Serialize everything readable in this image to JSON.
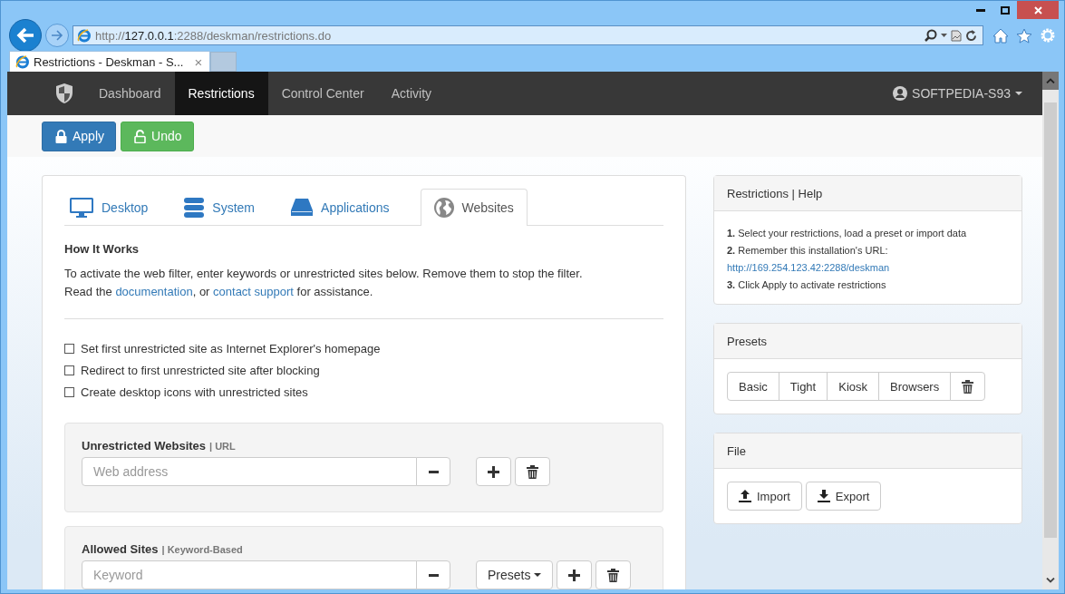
{
  "browser": {
    "address": {
      "scheme": "http://",
      "host": "127.0.0.1",
      "path": ":2288/deskman/restrictions.do"
    },
    "tabs": [
      {
        "title": "Restrictions - Deskman - S...",
        "close": "×",
        "selected": true
      }
    ]
  },
  "navbar": {
    "items": [
      {
        "label": "Dashboard",
        "selected": false
      },
      {
        "label": "Restrictions",
        "selected": true
      },
      {
        "label": "Control Center",
        "selected": false
      },
      {
        "label": "Activity",
        "selected": false
      }
    ],
    "user": "SOFTPEDIA-S93"
  },
  "toolbar": {
    "buttons": [
      {
        "label": "Apply",
        "kind": "primary"
      },
      {
        "label": "Undo",
        "kind": "success"
      }
    ]
  },
  "category_tabs": [
    {
      "label": "Desktop",
      "selected": false
    },
    {
      "label": "System",
      "selected": false
    },
    {
      "label": "Applications",
      "selected": false
    },
    {
      "label": "Websites",
      "selected": true
    }
  ],
  "how_it_works": {
    "heading": "How It Works",
    "line_1": "To activate the web filter, enter keywords or unrestricted sites below. Remove them to stop the filter.",
    "line_2": [
      {
        "kind": "text",
        "text": "Read the "
      },
      {
        "kind": "link",
        "text": "documentation"
      },
      {
        "kind": "text",
        "text": ", or "
      },
      {
        "kind": "link",
        "text": "contact support"
      },
      {
        "kind": "text",
        "text": " for assistance."
      }
    ]
  },
  "options": [
    {
      "label": "Set first unrestricted site as Internet Explorer's homepage",
      "checked": false
    },
    {
      "label": "Redirect to first unrestricted site after blocking",
      "checked": false
    },
    {
      "label": "Create desktop icons with unrestricted sites",
      "checked": false
    }
  ],
  "sections": [
    {
      "title": "Unrestricted Websites",
      "subtitle": "| URL",
      "placeholder": "Web address"
    },
    {
      "title": "Allowed Sites",
      "subtitle": "| Keyword-Based",
      "placeholder": "Keyword",
      "dropdown": "Presets"
    }
  ],
  "help_panel": {
    "title": "Restrictions | Help",
    "lines": [
      {
        "kind": "step",
        "text": "**1.** Select your restrictions, load a preset or import data"
      },
      {
        "kind": "step",
        "text": "**2.** Remember this installation's URL:"
      },
      {
        "kind": "link",
        "text": "http://169.254.123.42:2288/deskman"
      },
      {
        "kind": "step",
        "text": "**3.** Click Apply to activate restrictions"
      }
    ]
  },
  "presets_panel": {
    "title": "Presets",
    "buttons": [
      "Basic",
      "Tight",
      "Kiosk",
      "Browsers"
    ]
  },
  "file_panel": {
    "title": "File",
    "buttons": [
      "Import",
      "Export"
    ]
  }
}
